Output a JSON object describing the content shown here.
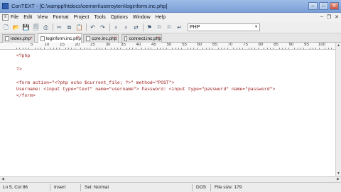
{
  "window": {
    "title": "ConTEXT - [C:\\xampp\\htdocs\\oerneri\\useroyten\\loginform.inc.php]",
    "controls": {
      "minimize": "–",
      "maximize": "□",
      "close": "✕"
    }
  },
  "menubar": {
    "items": [
      "File",
      "Edit",
      "View",
      "Format",
      "Project",
      "Tools",
      "Options",
      "Window",
      "Help"
    ],
    "mdi_controls": {
      "minimize": "–",
      "restore": "❐",
      "close": "✕"
    }
  },
  "toolbar": {
    "buttons": [
      "new-file",
      "open-file",
      "save",
      "save-all",
      "print",
      "cut",
      "copy",
      "paste",
      "undo",
      "redo",
      "find",
      "find-next",
      "replace",
      "bookmark-toggle",
      "bookmark-next",
      "bookmark-prev",
      "word-wrap"
    ],
    "language": "PHP",
    "language_arrow": "▾"
  },
  "tabs": [
    {
      "label": "index.php",
      "active": false
    },
    {
      "label": "loginform.inc.php",
      "active": true
    },
    {
      "label": "core.inc.php",
      "active": false
    },
    {
      "label": "connect.inc.php",
      "active": false
    }
  ],
  "ruler": {
    "labels": [
      "5",
      "10",
      "15",
      "20",
      "25",
      "30",
      "35",
      "40",
      "45",
      "50",
      "55",
      "60",
      "65",
      "70",
      "75",
      "80",
      "85",
      "90",
      "95",
      "100"
    ]
  },
  "editor": {
    "lines": [
      "<?php",
      "",
      "?>",
      "",
      "<form action=\"<?php echo $current_file; ?>\" method=\"POST\">",
      "Username: <input type=\"text\" name=\"username\"> Password: <input type=\"password\" name=\"password\">",
      "</form>"
    ]
  },
  "statusbar": {
    "position": "Ln 5, Col 86",
    "mode": "Insert",
    "selection": "Sel: Normal",
    "line_endings": "DOS",
    "file_size": "File size: 179"
  }
}
